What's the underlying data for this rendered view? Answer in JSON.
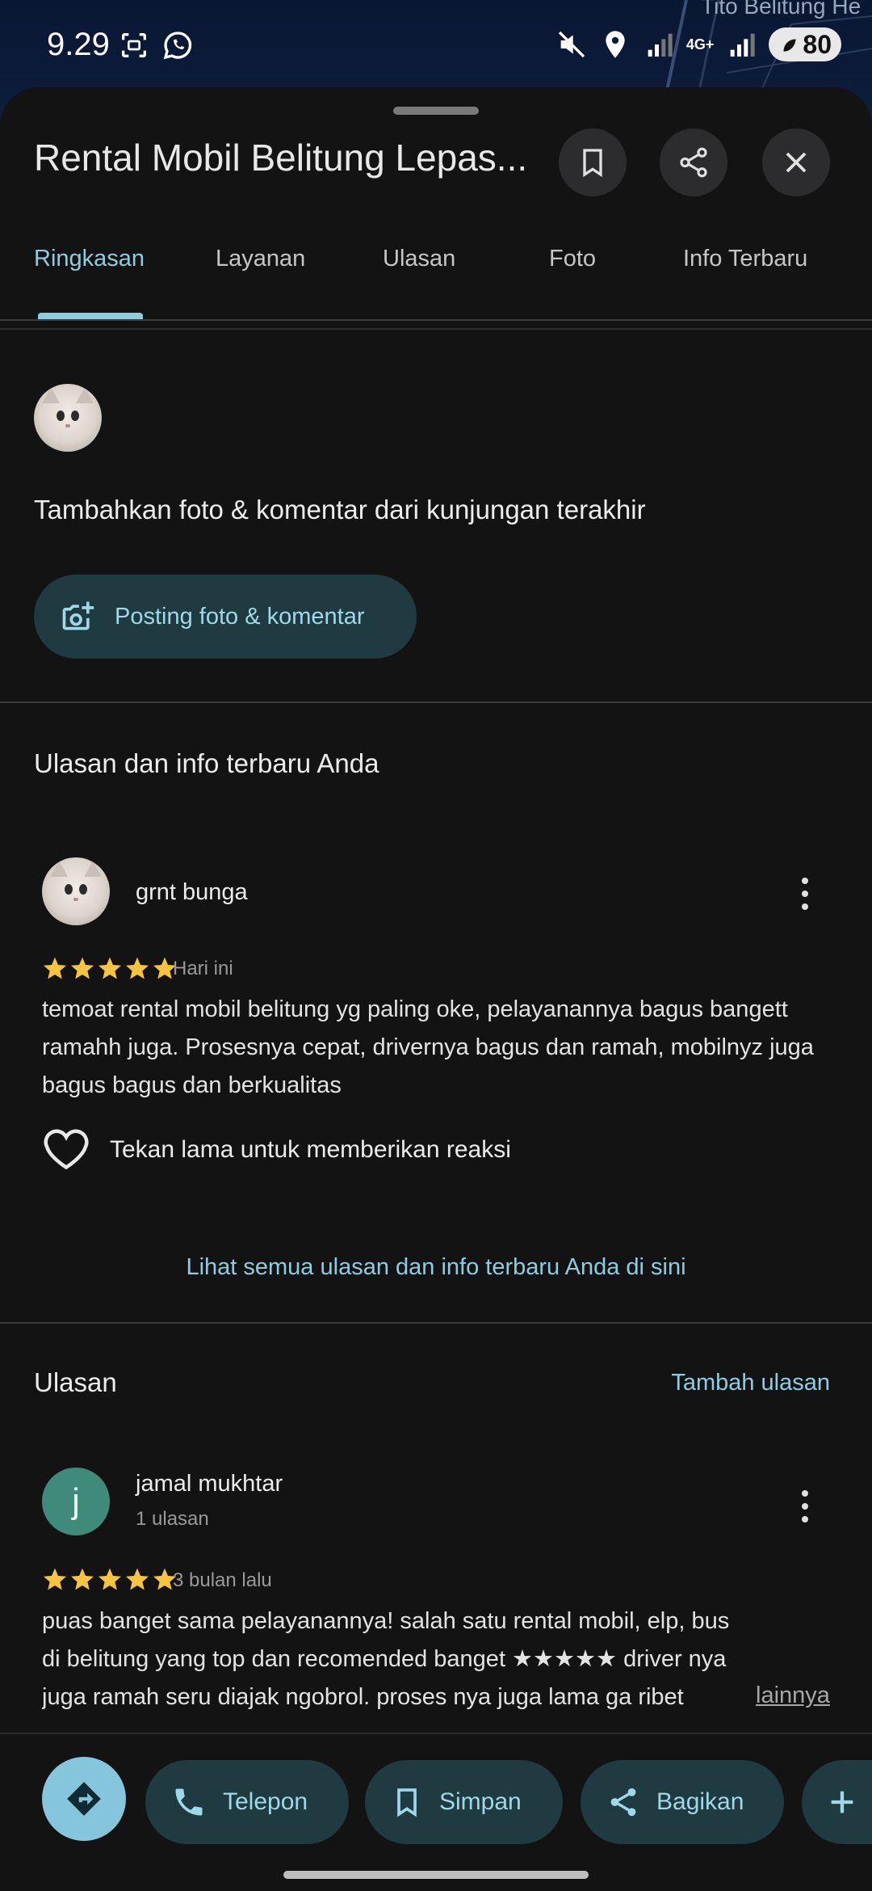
{
  "status_bar": {
    "time": "9.29",
    "network": "4G+",
    "battery": "80",
    "map_label": "Tito Belitung He"
  },
  "place": {
    "title": "Rental Mobil Belitung Lepas..."
  },
  "tabs": [
    {
      "label": "Ringkasan"
    },
    {
      "label": "Layanan"
    },
    {
      "label": "Ulasan"
    },
    {
      "label": "Foto"
    },
    {
      "label": "Info Terbaru"
    }
  ],
  "add_photo": {
    "heading": "Tambahkan foto & komentar dari kunjungan terakhir",
    "button_label": "Posting foto & komentar"
  },
  "my_reviews": {
    "heading": "Ulasan dan info terbaru Anda",
    "review": {
      "name": "grnt bunga",
      "rating": 5,
      "time": "Hari ini",
      "text": "temoat rental mobil belitung yg paling oke, pelayanannya bagus bangett ramahh juga. Prosesnya cepat, drivernya bagus dan ramah, mobilnyz juga bagus bagus dan berkualitas",
      "react_label": "Tekan lama untuk memberikan reaksi"
    },
    "see_all_link": "Lihat semua ulasan dan info terbaru Anda di sini"
  },
  "reviews": {
    "heading": "Ulasan",
    "add_link": "Tambah ulasan",
    "items": [
      {
        "initial": "j",
        "name": "jamal mukhtar",
        "count": "1 ulasan",
        "rating": 5,
        "time": "3 bulan lalu",
        "text": "puas banget sama pelayanannya! salah satu rental mobil, elp, bus di belitung yang top dan recomended banget ★★★★★ driver nya juga ramah seru diajak ngobrol. proses nya juga lama ga ribet langsun...",
        "more": "lainnya"
      }
    ]
  },
  "actions": {
    "call": "Telepon",
    "save": "Simpan",
    "share": "Bagikan"
  },
  "colors": {
    "accent": "#8ecde0",
    "pill_bg": "#1f3a40",
    "star": "#f6c343",
    "sheet_bg": "#131314"
  }
}
